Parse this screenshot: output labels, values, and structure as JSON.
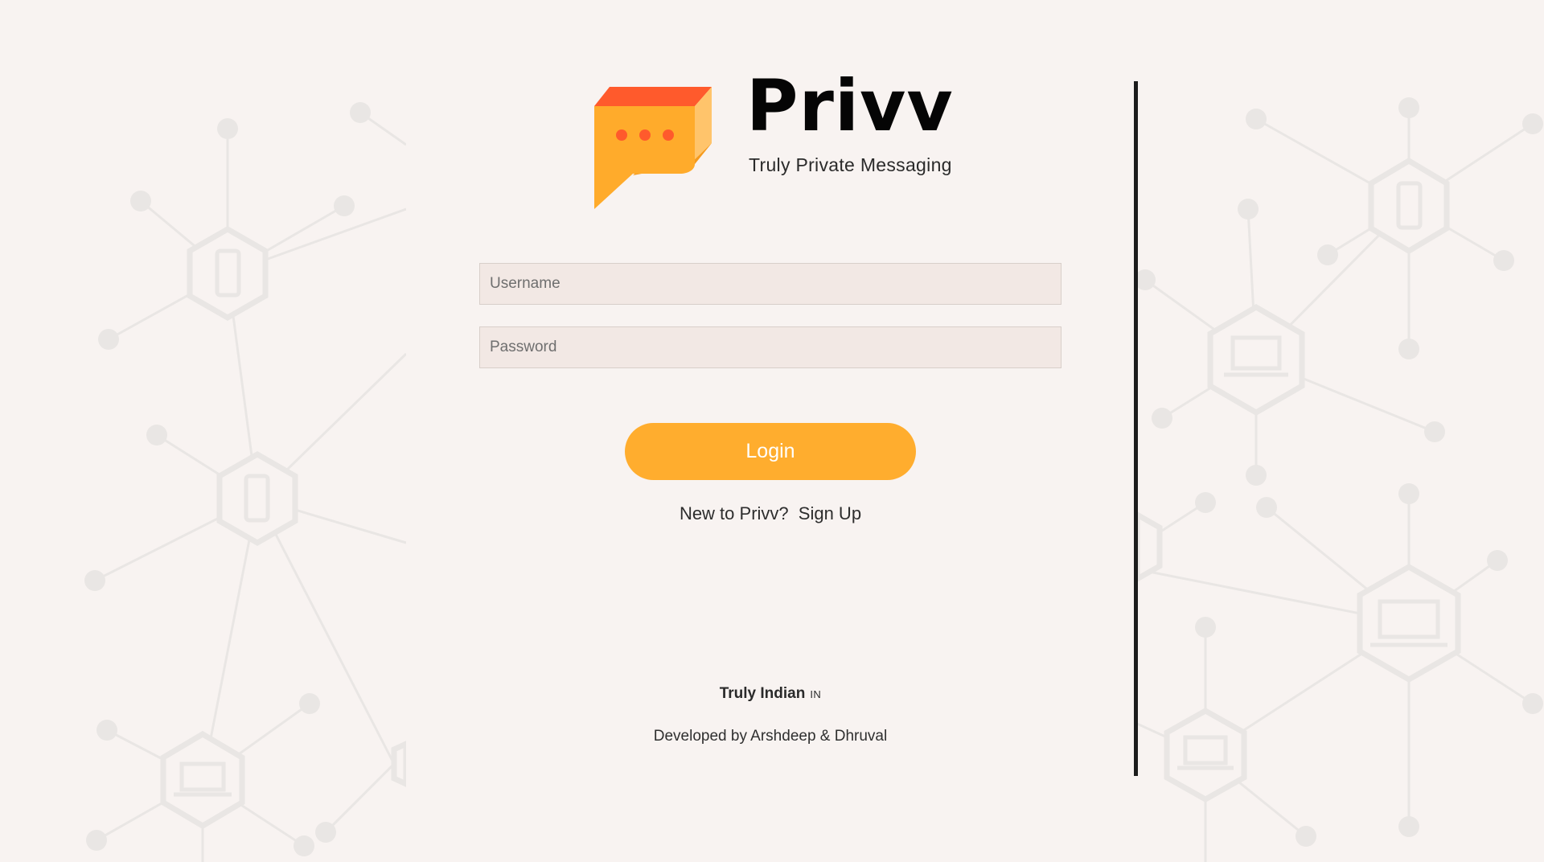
{
  "brand": {
    "name": "Privv",
    "tagline": "Truly Private Messaging",
    "colors": {
      "primary": "#ffad2e",
      "accent": "#ff5a2c",
      "logo_body": "#ffab2b"
    }
  },
  "form": {
    "username_placeholder": "Username",
    "password_placeholder": "Password",
    "login_label": "Login",
    "signup_prompt": "New to Privv?",
    "signup_link": "Sign Up"
  },
  "footer": {
    "made_in": "Truly Indian",
    "flag": "IN",
    "developed_by": "Developed by Arshdeep & Dhruval"
  },
  "icons": {
    "logo": "chat-bubble-icon",
    "background": "network-devices-pattern"
  }
}
